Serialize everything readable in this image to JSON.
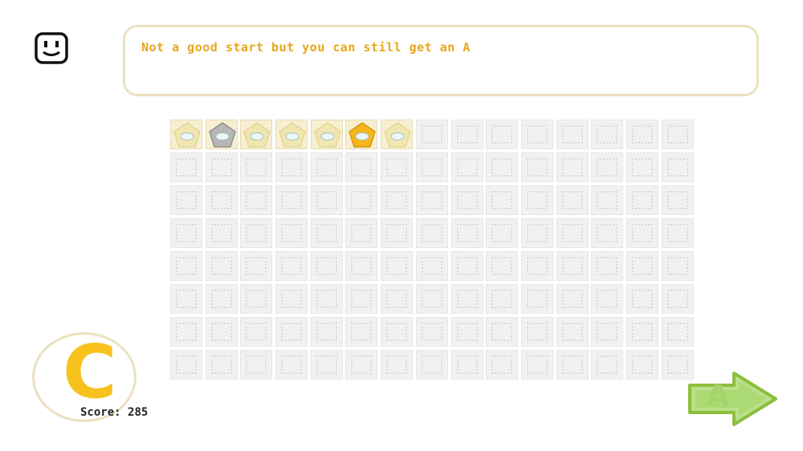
{
  "message": {
    "text": "Not a good start but you can still get an A"
  },
  "icons": {
    "mascot": "smiley-face-icon",
    "next": "next-arrow-icon"
  },
  "grid": {
    "columns": 15,
    "rows": 8,
    "pieces": [
      {
        "type": "pentagon",
        "color": "pale-gold"
      },
      {
        "type": "pentagon",
        "color": "silver"
      },
      {
        "type": "pentagon",
        "color": "pale-gold"
      },
      {
        "type": "pentagon",
        "color": "pale-gold"
      },
      {
        "type": "pentagon",
        "color": "pale-gold"
      },
      {
        "type": "pentagon",
        "color": "gold"
      },
      {
        "type": "pentagon",
        "color": "pale-gold"
      }
    ]
  },
  "grade": {
    "current": "C",
    "target": "A"
  },
  "score": {
    "label": "Score:",
    "value": "285"
  },
  "colors": {
    "accent_text": "#e8a61c",
    "grade_yellow": "#f7c21c",
    "border_beige": "#ebe1bd",
    "arrow_green": "#9acd4b",
    "piece_pale": "#f1e5b0",
    "piece_gold": "#f5b51b",
    "piece_silver": "#b7b7b7"
  }
}
